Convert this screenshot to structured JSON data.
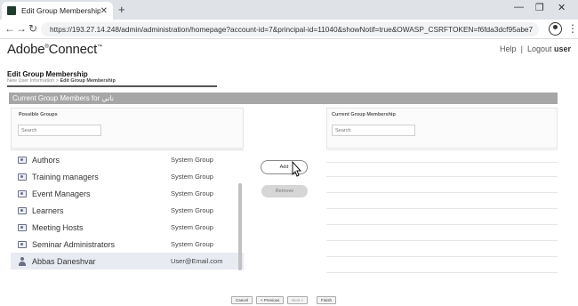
{
  "browser": {
    "tab_title": "Edit Group Membership",
    "url": "https://193.27.14.248/admin/administration/homepage?account-id=7&principal-id=11040&showNotif=true&OWASP_CSRFTOKEN=f6fda3dcf95abe7"
  },
  "header": {
    "logo_main": "Adobe",
    "logo_reg": "®",
    "logo_tail": "Connect",
    "logo_tm": "™",
    "help": "Help",
    "separator": "|",
    "logout": "Logout",
    "user": "user"
  },
  "page": {
    "title": "Edit Group Membership",
    "breadcrumb_prev": "New User Information",
    "breadcrumb_sep": " > ",
    "breadcrumb_current": "Edit Group Membership",
    "section_title": "Current Group Members for ناني"
  },
  "possible_groups": {
    "header": "Possible Groups",
    "search_placeholder": "Search",
    "rows": [
      {
        "name": "Authors",
        "type": "System Group"
      },
      {
        "name": "Training managers",
        "type": "System Group"
      },
      {
        "name": "Event Managers",
        "type": "System Group"
      },
      {
        "name": "Learners",
        "type": "System Group"
      },
      {
        "name": "Meeting Hosts",
        "type": "System Group"
      },
      {
        "name": "Seminar Administrators",
        "type": "System Group"
      },
      {
        "name": "Abbas Daneshvar",
        "type": "User@Email.com"
      }
    ]
  },
  "current_membership": {
    "header": "Current Group Membership",
    "search_placeholder": "Search"
  },
  "actions": {
    "add": "Add",
    "remove": "Remove"
  },
  "footer": {
    "cancel": "Cancel",
    "previous": "< Previous",
    "next": "Next >",
    "finish": "Finish"
  }
}
